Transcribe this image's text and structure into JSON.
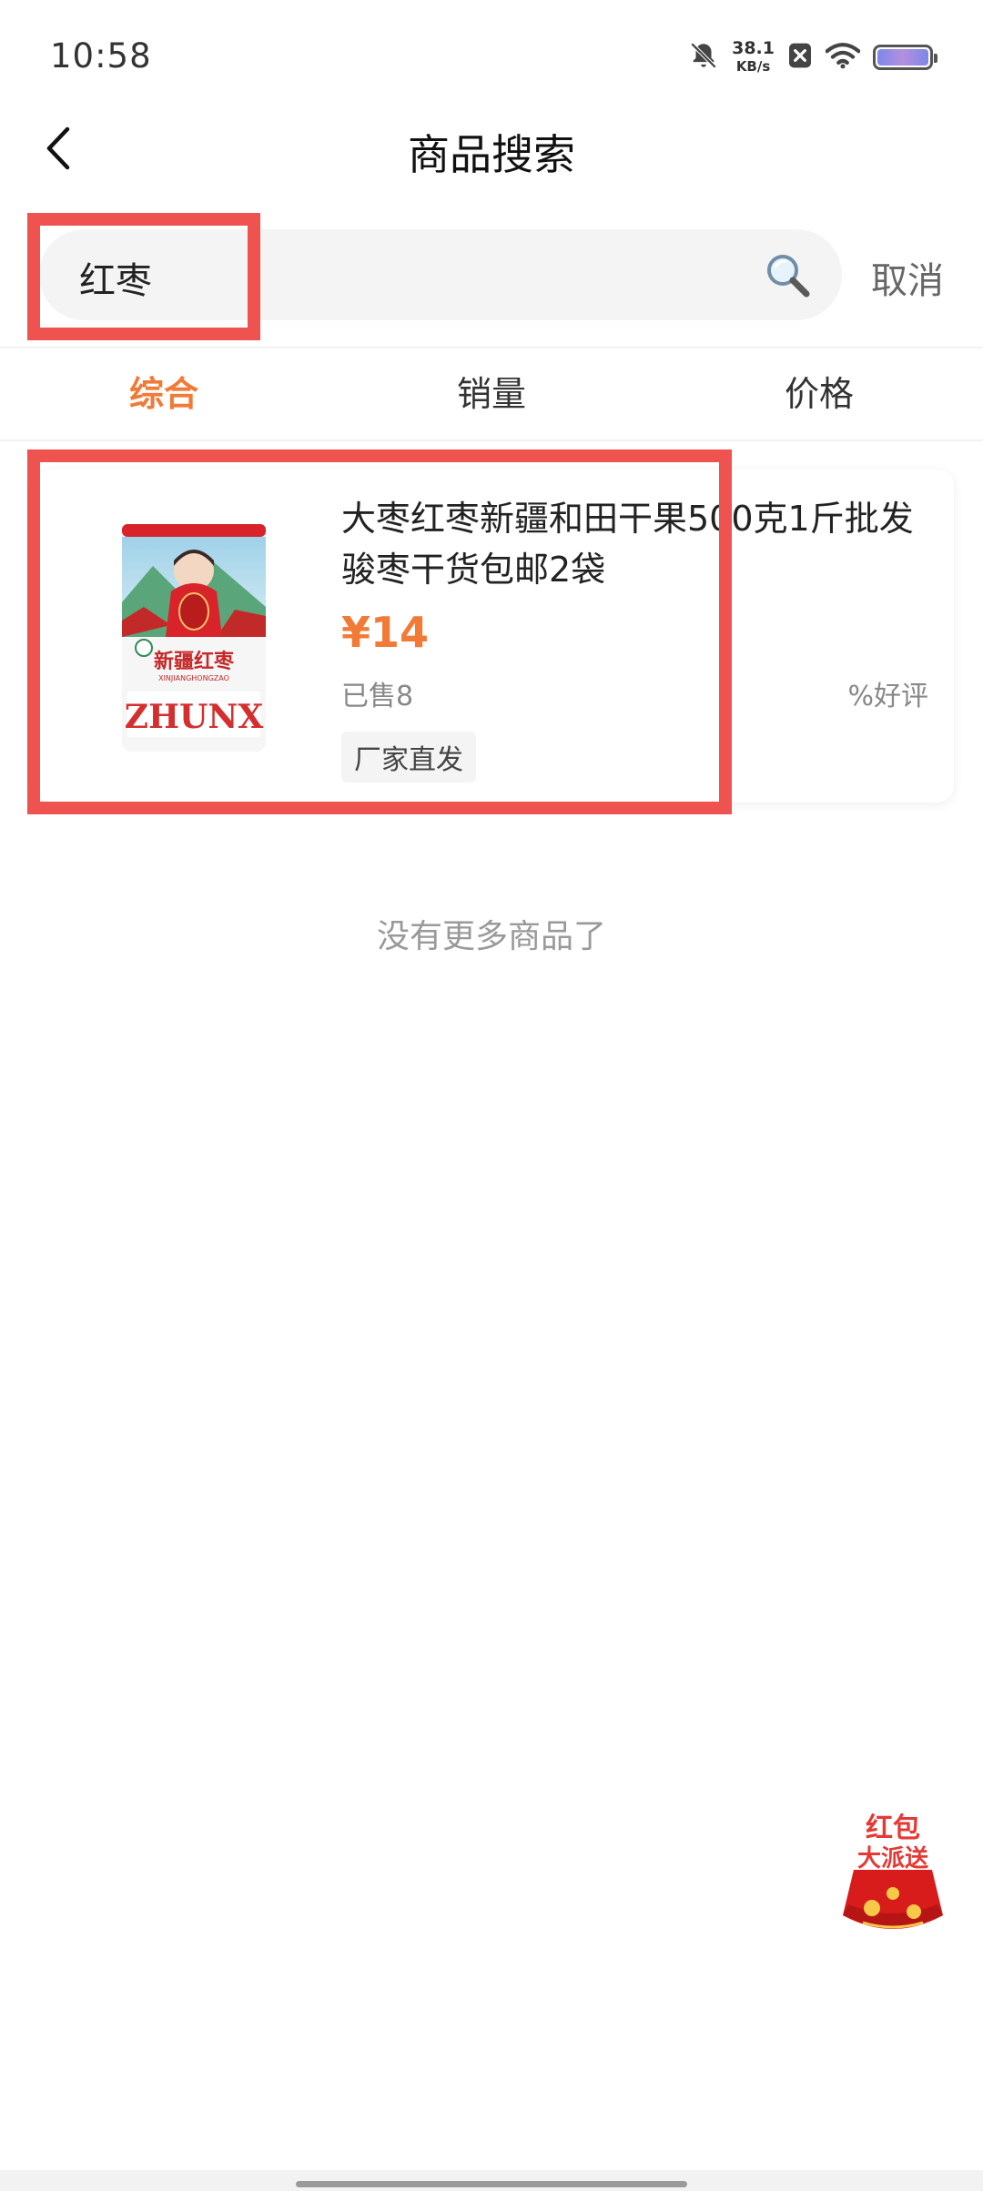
{
  "status_bar": {
    "time": "10:58",
    "net_speed_value": "38.1",
    "net_speed_unit": "KB/s",
    "icons": [
      "bell-off-icon",
      "close-badge-icon",
      "wifi-icon",
      "battery-icon"
    ]
  },
  "header": {
    "title": "商品搜索",
    "back_icon": "chevron-left-icon"
  },
  "search": {
    "value": "红枣",
    "icon": "magnifier-icon",
    "cancel_label": "取消"
  },
  "tabs": [
    {
      "label": "综合",
      "active": true
    },
    {
      "label": "销量",
      "active": false
    },
    {
      "label": "价格",
      "active": false
    }
  ],
  "products": [
    {
      "title": "大枣红枣新疆和田干果500克1斤批发骏枣干货包邮2袋",
      "price": "¥14",
      "sold": "已售8",
      "rating": "%好评",
      "tag": "厂家直发",
      "image_package_text": "新疆红枣",
      "image_brand": "ZHUNX"
    }
  ],
  "footer_message": "没有更多商品了",
  "floating": {
    "red_packet_line1": "红包",
    "red_packet_line2": "大派送"
  },
  "colors": {
    "accent": "#f07a36",
    "annotation": "#ef5350"
  }
}
